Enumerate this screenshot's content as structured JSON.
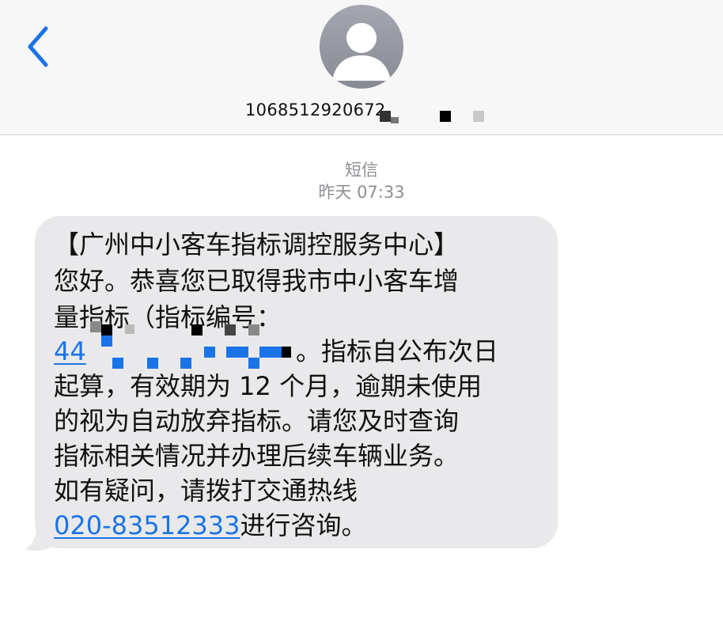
{
  "header": {
    "contact_number_visible": "1068512920672"
  },
  "thread": {
    "message_type": "短信",
    "timestamp": "昨天 07:33"
  },
  "message": {
    "line1": "【广州中小客车指标调控服务中心】",
    "line2": "您好。恭喜您已取得我市中小客车增",
    "line3": "量指标（指标编号：",
    "line4_link_prefix": "44",
    "line4_rest": "。指标自公布次日",
    "line5": "起算，有效期为 12 个月，逾期未使用",
    "line6": "的视为自动放弃指标。请您及时查询",
    "line7": "指标相关情况并办理后续车辆业务。",
    "line8": "如有疑问，请拨打交通热线",
    "line9_phone": "020-83512333",
    "line9_rest": "进行咨询。"
  },
  "colors": {
    "accent_blue": "#1a73e8",
    "bubble_gray": "#e9e9eb",
    "header_bg": "#f7f7f7",
    "meta_gray": "#8e8e93"
  },
  "icons": {
    "back": "chevron-left-icon",
    "avatar": "person-silhouette-icon"
  }
}
